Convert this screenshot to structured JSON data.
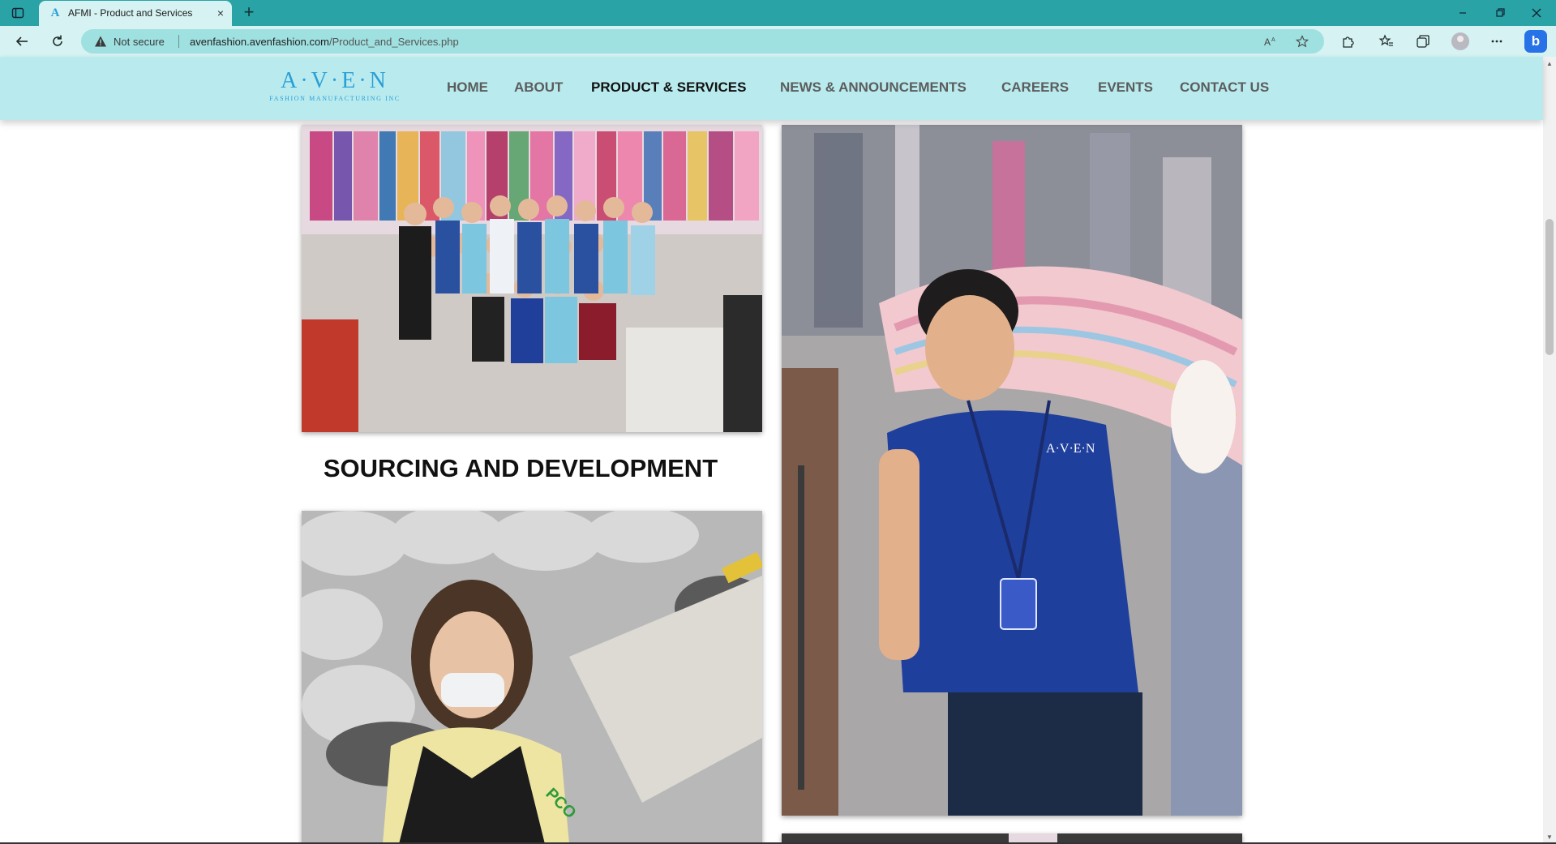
{
  "browser": {
    "tab": {
      "favicon": "A",
      "title": "AFMI - Product and Services",
      "close_icon": "×"
    },
    "new_tab_icon": "+",
    "address": {
      "security_icon": "warning-triangle-icon",
      "security_label": "Not secure",
      "url_host": "avenfashion.avenfashion.com",
      "url_path": "/Product_and_Services.php"
    },
    "window_controls": [
      "minimize",
      "restore",
      "close"
    ]
  },
  "site": {
    "logo": {
      "mark": "A·V·E·N",
      "sub": "FASHION MANUFACTURING INC"
    },
    "nav": [
      {
        "label": "HOME",
        "active": false
      },
      {
        "label": "ABOUT",
        "active": false
      },
      {
        "label": "PRODUCT & SERVICES",
        "active": true
      },
      {
        "label": "NEWS & ANNOUNCEMENTS",
        "active": false
      },
      {
        "label": "CAREERS",
        "active": false
      },
      {
        "label": "EVENTS",
        "active": false
      },
      {
        "label": "CONTACT US",
        "active": false
      }
    ]
  },
  "content": {
    "section_title": "SOURCING AND DEVELOPMENT"
  },
  "colors": {
    "tabbar": "#2aa3a7",
    "addrbar": "#d6f2f2",
    "header": "#b9ebee",
    "logo": "#2a9fd6"
  }
}
